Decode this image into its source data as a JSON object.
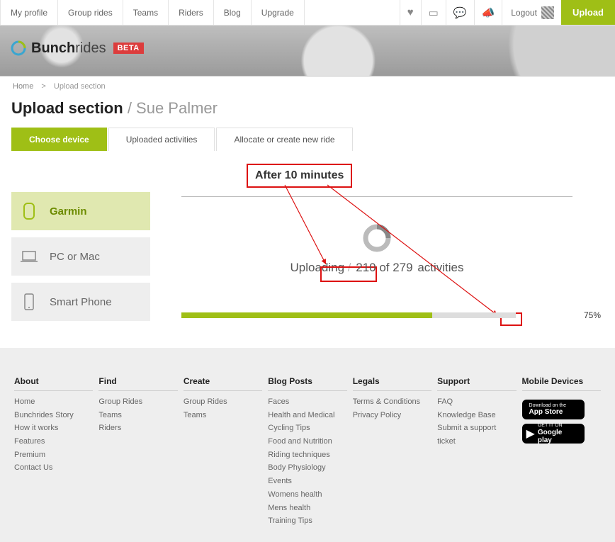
{
  "nav": {
    "items": [
      {
        "label": "My profile"
      },
      {
        "label": "Group rides"
      },
      {
        "label": "Teams"
      },
      {
        "label": "Riders"
      },
      {
        "label": "Blog"
      },
      {
        "label": "Upgrade"
      }
    ],
    "logout": "Logout",
    "upload": "Upload"
  },
  "brand": {
    "name_bold": "Bunch",
    "name_light": "rides",
    "beta": "BETA"
  },
  "breadcrumb": {
    "home": "Home",
    "current": "Upload section"
  },
  "title": {
    "section": "Upload section",
    "user": "Sue Palmer"
  },
  "tabs": [
    {
      "label": "Choose device",
      "active": true
    },
    {
      "label": "Uploaded activities",
      "active": false
    },
    {
      "label": "Allocate or create new ride",
      "active": false
    }
  ],
  "devices": [
    {
      "label": "Garmin",
      "selected": true
    },
    {
      "label": "PC or Mac",
      "selected": false
    },
    {
      "label": "Smart Phone",
      "selected": false
    }
  ],
  "annotation": {
    "label": "After 10 minutes"
  },
  "upload": {
    "prefix": "Uploading",
    "counts": "210 of 279",
    "suffix": "activities",
    "percent": 75,
    "percent_label": "75%"
  },
  "footer": {
    "cols": [
      {
        "heading": "About",
        "links": [
          "Home",
          "Bunchrides Story",
          "How it works",
          "Features",
          "Premium",
          "Contact Us"
        ]
      },
      {
        "heading": "Find",
        "links": [
          "Group Rides",
          "Teams",
          "Riders"
        ]
      },
      {
        "heading": "Create",
        "links": [
          "Group Rides",
          "Teams"
        ]
      },
      {
        "heading": "Blog Posts",
        "links": [
          "Faces",
          "Health and Medical",
          "Cycling Tips",
          "Food and Nutrition",
          "Riding techniques",
          "Body Physiology",
          "Events",
          "Womens health",
          "Mens health",
          "Training Tips"
        ]
      },
      {
        "heading": "Legals",
        "links": [
          "Terms & Conditions",
          "Privacy Policy"
        ]
      },
      {
        "heading": "Support",
        "links": [
          "FAQ",
          "Knowledge Base",
          "Submit a support ticket"
        ]
      }
    ],
    "mobile_heading": "Mobile Devices",
    "appstore_small": "Download on the",
    "appstore_big": "App Store",
    "play_small": "GET IT ON",
    "play_big": "Google play"
  }
}
